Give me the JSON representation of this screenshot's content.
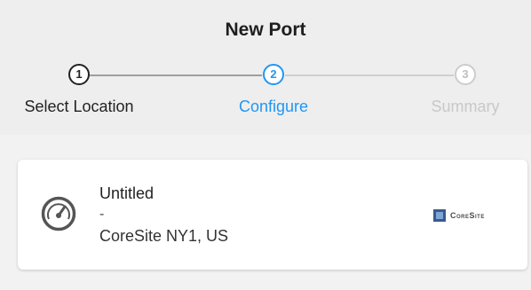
{
  "header": {
    "title": "New Port"
  },
  "stepper": {
    "steps": [
      {
        "number": "1",
        "label": "Select Location",
        "state": "completed"
      },
      {
        "number": "2",
        "label": "Configure",
        "state": "active"
      },
      {
        "number": "3",
        "label": "Summary",
        "state": "upcoming"
      }
    ],
    "colors": {
      "completed": "#222222",
      "active": "#2196f3",
      "upcoming": "#cccccc"
    }
  },
  "port_card": {
    "icon": "speedometer-icon",
    "name": "Untitled",
    "separator": "-",
    "location": "CoreSite NY1, US",
    "provider_logo": {
      "icon": "coresite-logo",
      "text": "CoreSite"
    }
  }
}
